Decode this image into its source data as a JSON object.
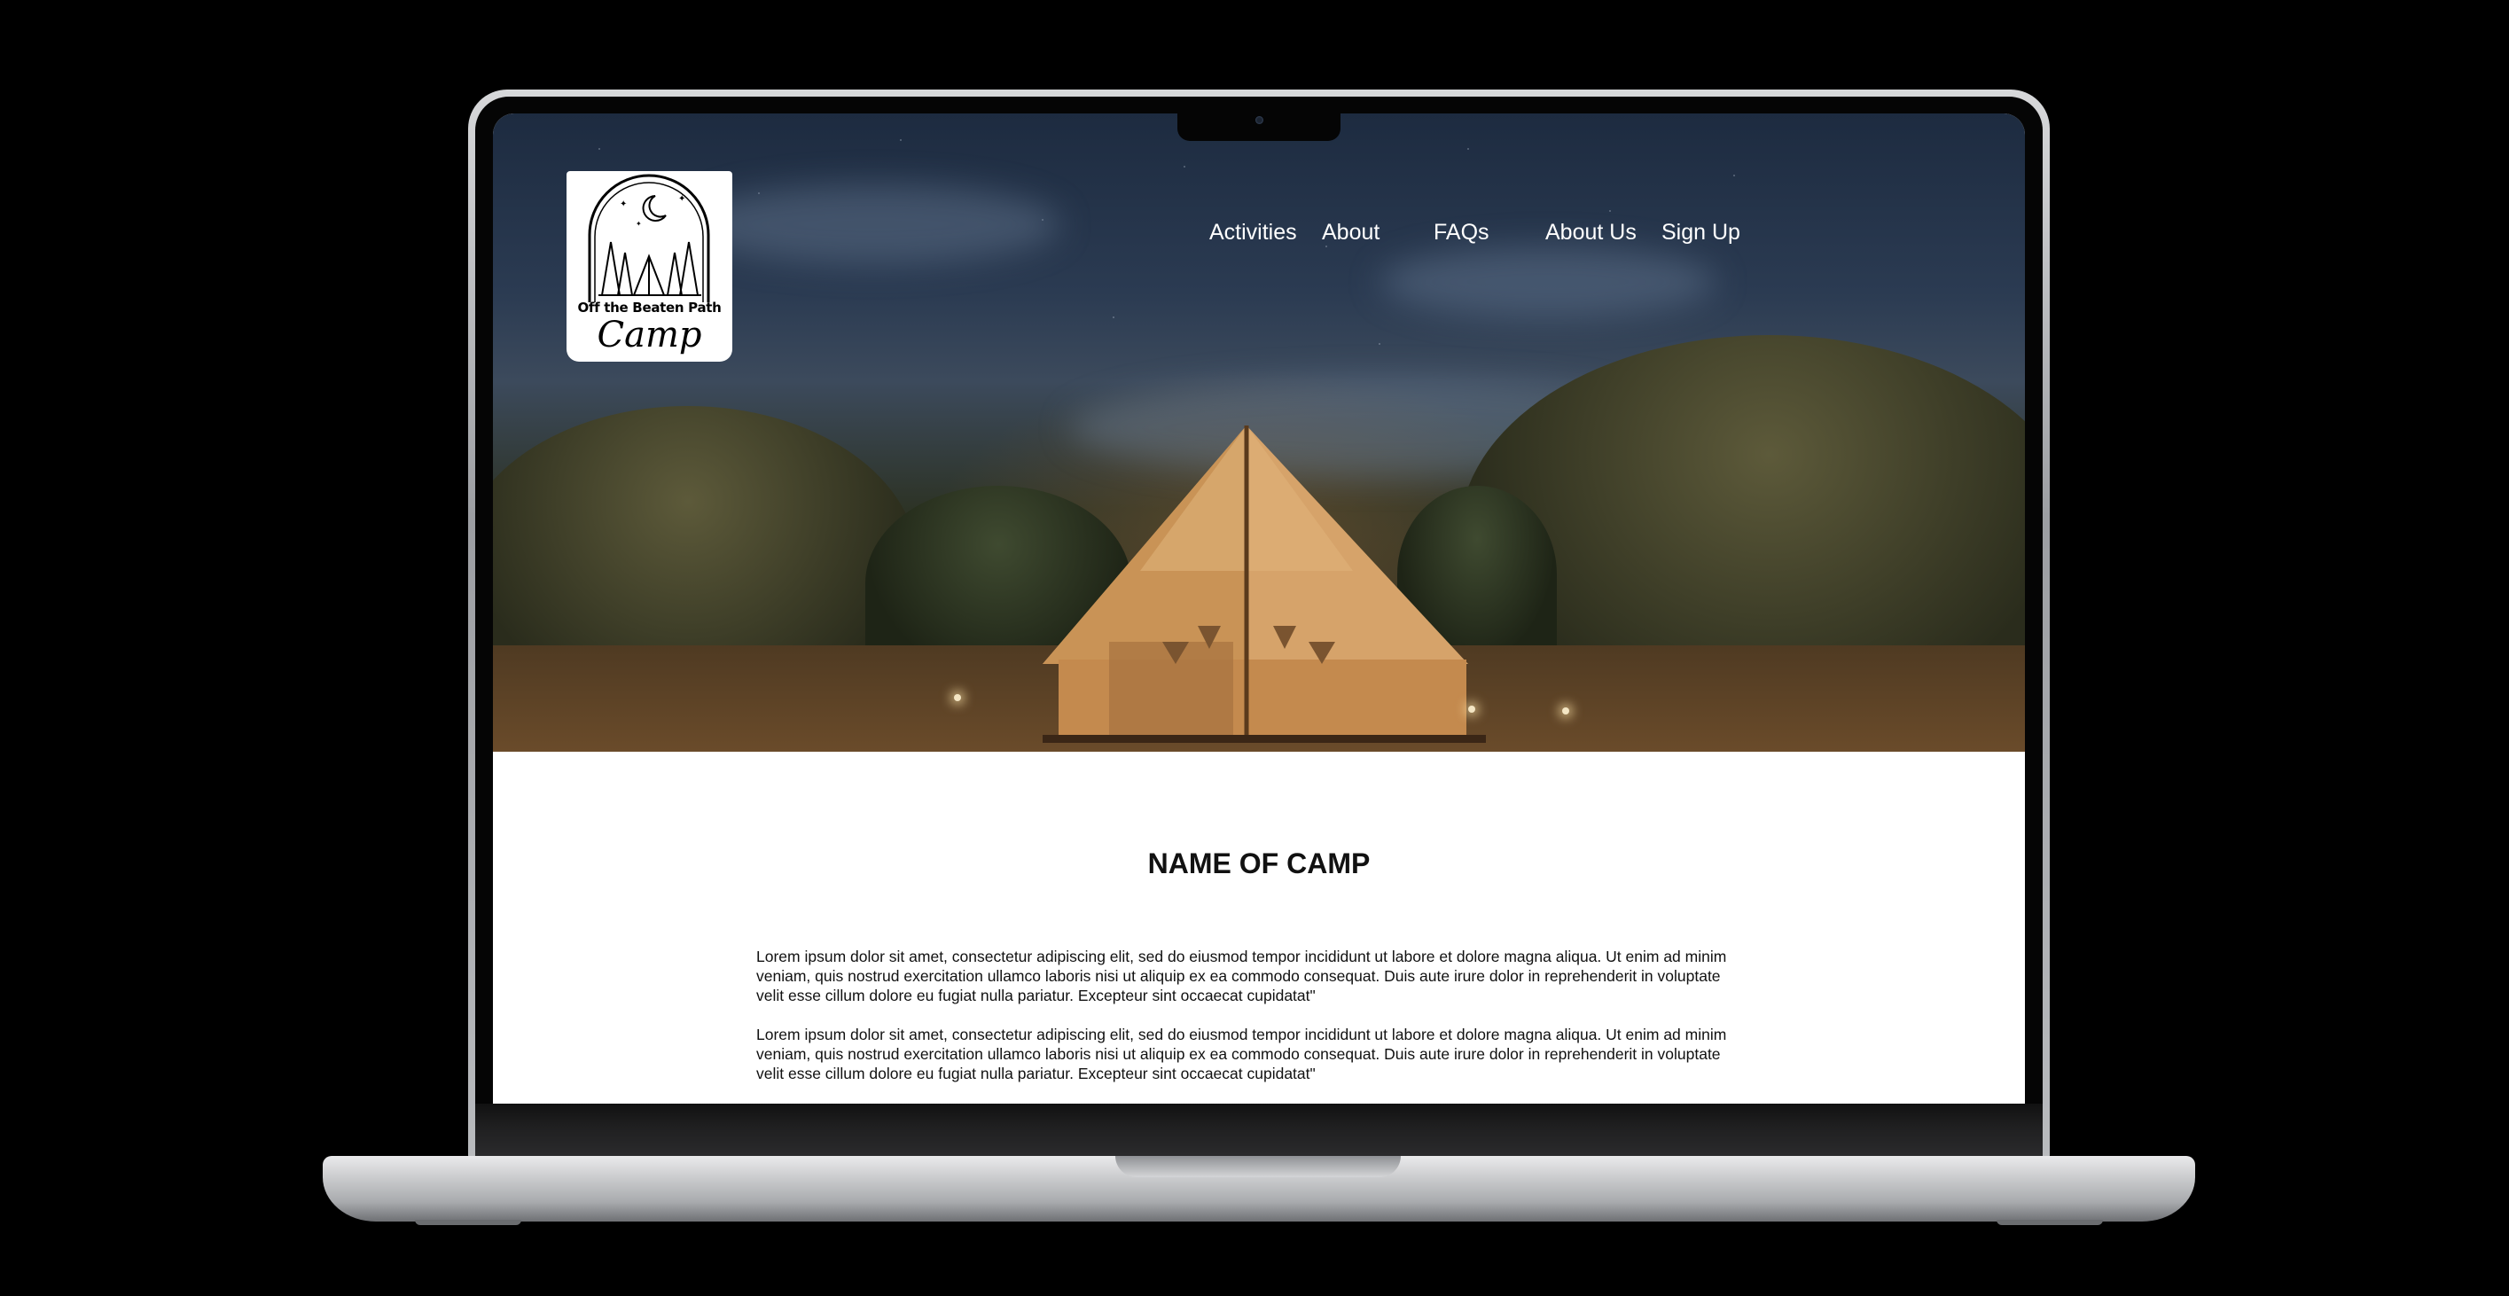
{
  "site": {
    "logo": {
      "line1": "Off the Beaten Path",
      "line2": "Camp"
    },
    "nav": [
      {
        "label": "Activities"
      },
      {
        "label": "About"
      },
      {
        "label": "FAQs"
      },
      {
        "label": "About Us"
      },
      {
        "label": "Sign Up"
      }
    ]
  },
  "hero": {
    "image": "night-tent-campsite"
  },
  "main": {
    "title": "NAME OF CAMP",
    "paragraphs": [
      "Lorem ipsum dolor sit amet, consectetur adipiscing elit, sed do eiusmod tempor incididunt ut labore et dolore magna aliqua. Ut enim ad minim veniam, quis nostrud exercitation ullamco laboris nisi ut aliquip ex ea commodo consequat. Duis aute irure dolor in reprehenderit in voluptate velit esse cillum dolore eu fugiat nulla pariatur. Excepteur sint occaecat cupidatat\"",
      "Lorem ipsum dolor sit amet, consectetur adipiscing elit, sed do eiusmod tempor incididunt ut labore et dolore magna aliqua. Ut enim ad minim veniam, quis nostrud exercitation ullamco laboris nisi ut aliquip ex ea commodo consequat. Duis aute irure dolor in reprehenderit in voluptate velit esse cillum dolore eu fugiat nulla pariatur. Excepteur sint occaecat cupidatat\""
    ]
  },
  "colors": {
    "background": "#000000",
    "hero_sky": "#1d2b40",
    "tent": "#d6a36a",
    "text": "#111111"
  }
}
